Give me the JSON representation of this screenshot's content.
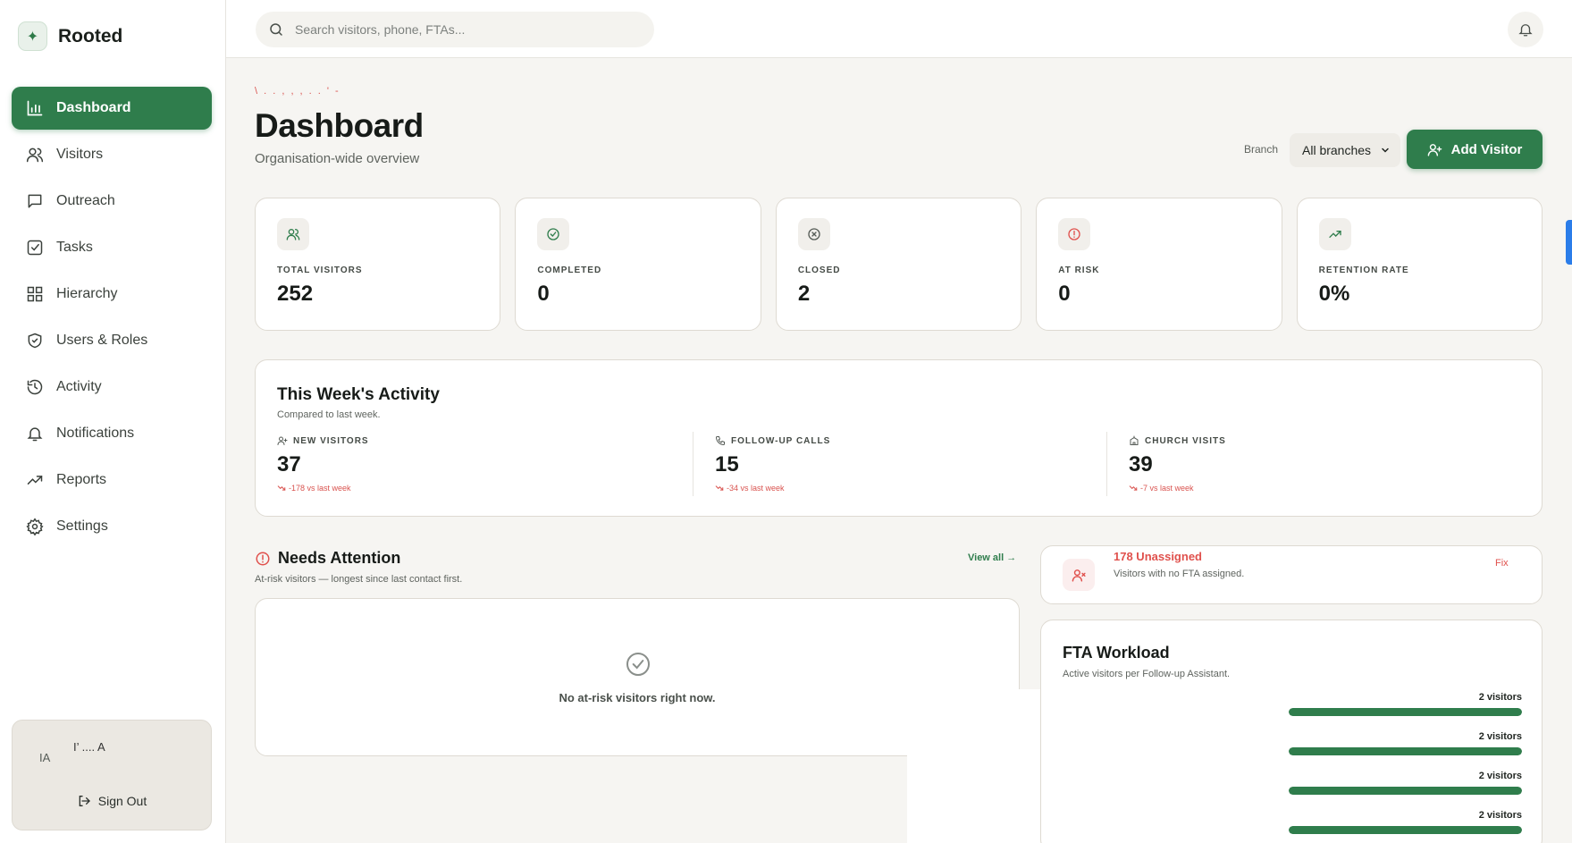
{
  "app": {
    "name": "Rooted"
  },
  "sidebar": {
    "items": [
      {
        "label": "Dashboard",
        "icon": "bar-chart-icon",
        "active": true
      },
      {
        "label": "Visitors",
        "icon": "users-icon"
      },
      {
        "label": "Outreach",
        "icon": "message-icon"
      },
      {
        "label": "Tasks",
        "icon": "check-square-icon"
      },
      {
        "label": "Hierarchy",
        "icon": "grid-icon"
      },
      {
        "label": "Users & Roles",
        "icon": "shield-icon"
      },
      {
        "label": "Activity",
        "icon": "history-icon"
      },
      {
        "label": "Notifications",
        "icon": "bell-icon"
      },
      {
        "label": "Reports",
        "icon": "trending-up-icon"
      },
      {
        "label": "Settings",
        "icon": "gear-icon"
      }
    ],
    "user": {
      "initials": "IA",
      "name": "I’ .... A"
    },
    "signout_label": "Sign Out"
  },
  "topbar": {
    "search_placeholder": "Search visitors, phone, FTAs..."
  },
  "header": {
    "breadcrumb": "\\ . . , , , .  . ' -",
    "title": "Dashboard",
    "subtitle": "Organisation-wide overview",
    "branch_label": "Branch",
    "branch_value": "All branches",
    "add_visitor_label": "Add Visitor"
  },
  "stats": [
    {
      "label": "TOTAL VISITORS",
      "value": "252",
      "icon": "users-icon",
      "color": "#2f7d4c"
    },
    {
      "label": "COMPLETED",
      "value": "0",
      "icon": "check-circle-icon",
      "color": "#2f7d4c"
    },
    {
      "label": "CLOSED",
      "value": "2",
      "icon": "x-circle-icon",
      "color": "#555b56"
    },
    {
      "label": "AT RISK",
      "value": "0",
      "icon": "alert-circle-icon",
      "color": "#e0514d"
    },
    {
      "label": "RETENTION RATE",
      "value": "0%",
      "icon": "trending-up-icon",
      "color": "#2f7d4c"
    }
  ],
  "week": {
    "title": "This Week's Activity",
    "subtitle": "Compared to last week.",
    "metrics": [
      {
        "label": "NEW VISITORS",
        "value": "37",
        "delta": "-178 vs last week",
        "icon": "user-plus-icon"
      },
      {
        "label": "FOLLOW-UP CALLS",
        "value": "15",
        "delta": "-34 vs last week",
        "icon": "phone-icon"
      },
      {
        "label": "CHURCH VISITS",
        "value": "39",
        "delta": "-7 vs last week",
        "icon": "church-icon"
      }
    ]
  },
  "attention": {
    "title": "Needs Attention",
    "subtitle": "At-risk visitors — longest since last contact first.",
    "view_all": "View all →",
    "empty_text": "No at-risk visitors right now."
  },
  "unassigned": {
    "title": "178 Unassigned",
    "subtitle": "Visitors with no FTA assigned.",
    "fix_label": "Fix"
  },
  "fta": {
    "title": "FTA Workload",
    "subtitle": "Active visitors per Follow-up Assistant.",
    "rows": [
      {
        "count": "2 visitors",
        "fill": 1.0
      },
      {
        "count": "2 visitors",
        "fill": 1.0
      },
      {
        "count": "2 visitors",
        "fill": 1.0
      },
      {
        "count": "2 visitors",
        "fill": 1.0
      }
    ]
  }
}
